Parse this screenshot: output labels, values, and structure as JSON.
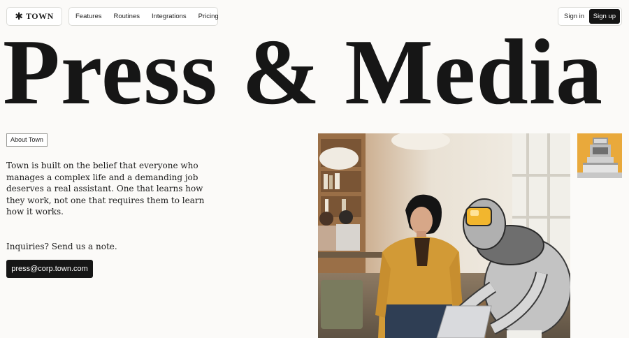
{
  "header": {
    "logo_text": "TOWN",
    "logo_icon": "asterisk-logo-icon",
    "nav": [
      "Features",
      "Routines",
      "Integrations",
      "Pricing"
    ],
    "sign_in": "Sign in",
    "sign_up": "Sign up"
  },
  "hero": {
    "title": "Press & Media"
  },
  "about": {
    "tag": "About Town",
    "body": "Town is built on the belief that everyone who manages a complex life and a demanding job deserves a real assistant. One that learns how they work, not one that requires them to learn how it works."
  },
  "contact": {
    "inquiry": "Inquiries? Send us a note.",
    "email": "press@corp.town.com"
  },
  "colors": {
    "background": "#fbfaf8",
    "text": "#161616",
    "thumbnail_bg": "#e9a93b",
    "robot_visor": "#f2b62e"
  }
}
